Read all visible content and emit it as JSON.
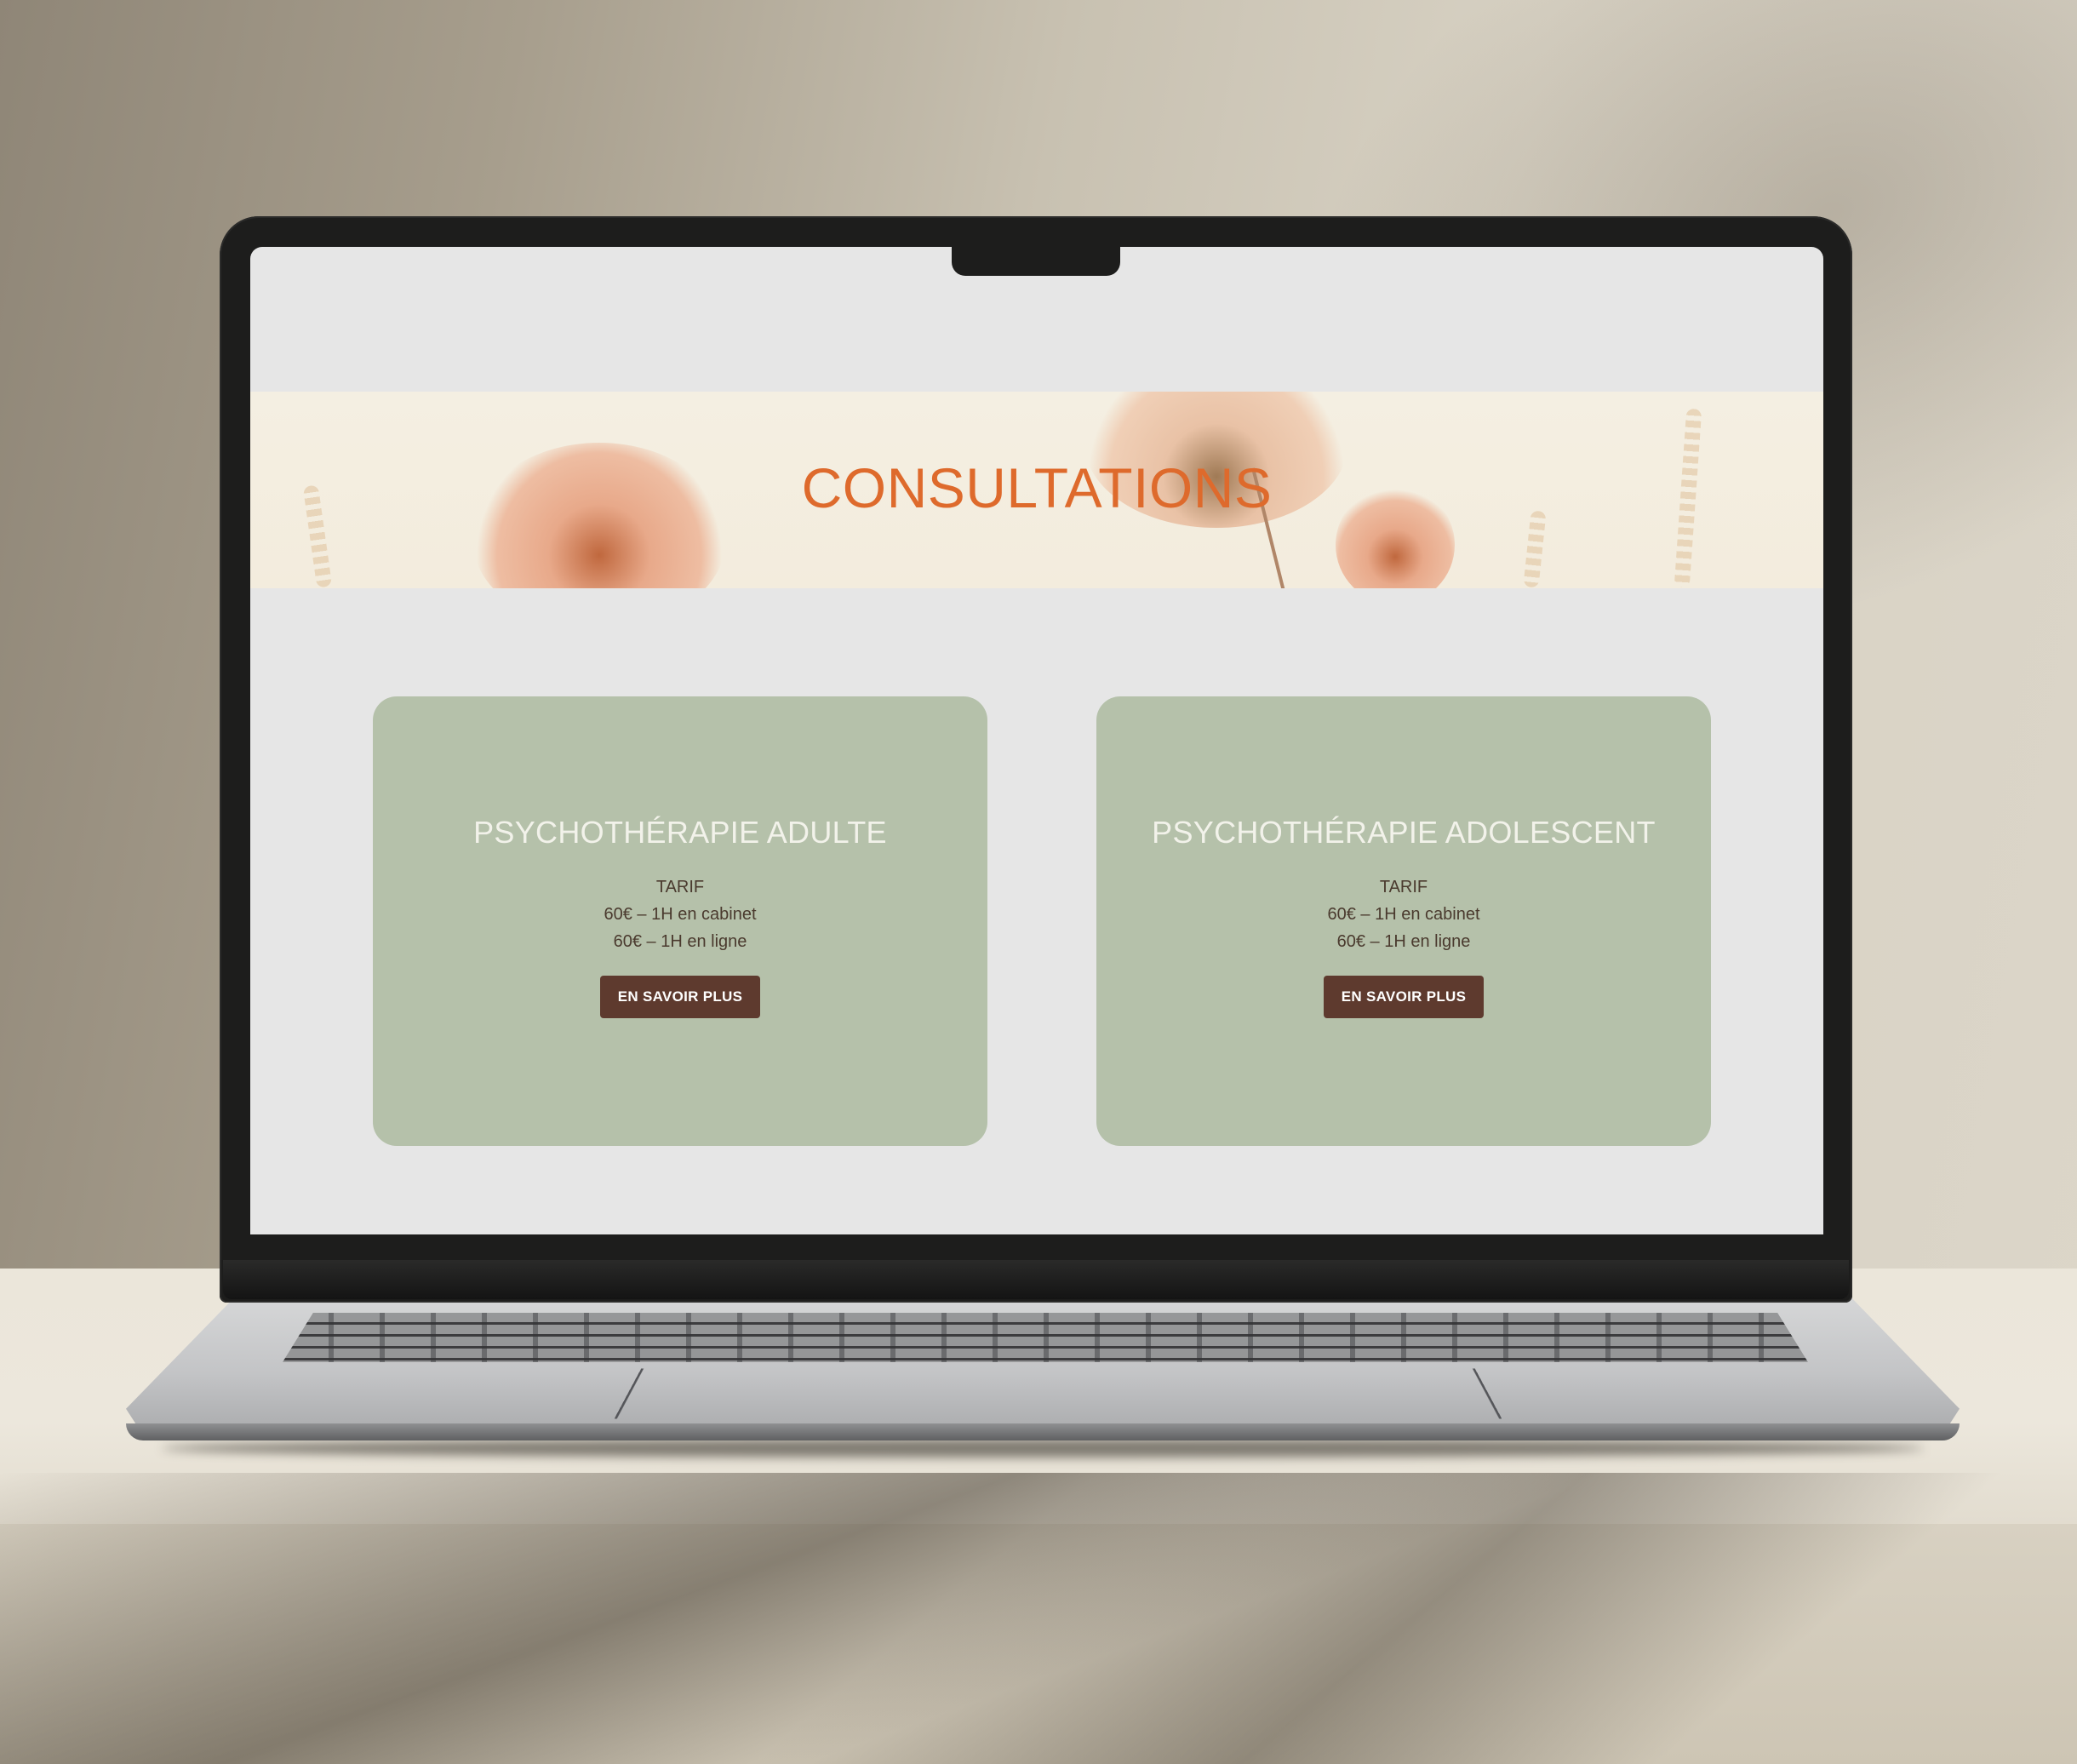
{
  "page": {
    "title": "CONSULTATIONS"
  },
  "cards": [
    {
      "title": "PSYCHOTHÉRAPIE ADULTE",
      "tarif_label": "TARIF",
      "price_lines": [
        "60€ – 1H en cabinet",
        "60€ – 1H en ligne"
      ],
      "button_label": "EN SAVOIR PLUS"
    },
    {
      "title": "PSYCHOTHÉRAPIE ADOLESCENT",
      "tarif_label": "TARIF",
      "price_lines": [
        "60€ – 1H en cabinet",
        "60€ – 1H en ligne"
      ],
      "button_label": "EN SAVOIR PLUS"
    }
  ],
  "colors": {
    "title_accent": "#de6a2c",
    "card_background": "#b5c1aa",
    "button_background": "#5e3a2e",
    "page_background": "#e6e6e6"
  }
}
